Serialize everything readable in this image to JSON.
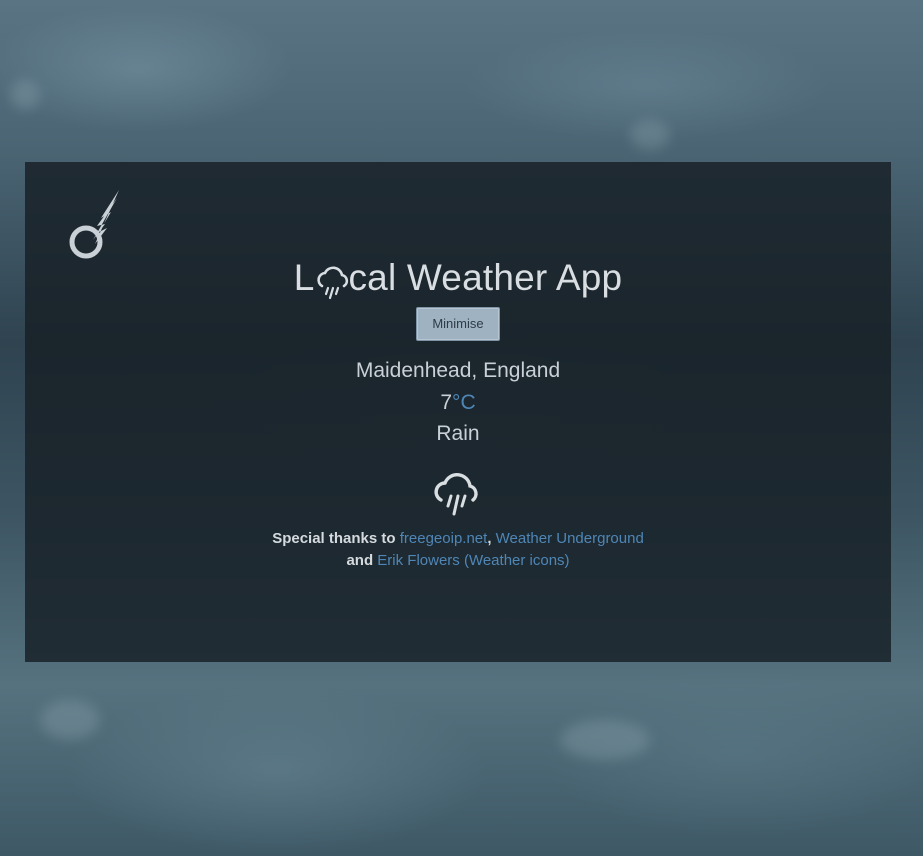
{
  "app": {
    "title_prefix": "L",
    "title_suffix": "cal Weather App",
    "title_icon": "rain-cloud-icon",
    "logo_icon": "comet-icon"
  },
  "controls": {
    "minimise_label": "Minimise"
  },
  "weather": {
    "location": "Maidenhead, England",
    "temperature": "7",
    "unit": "°C",
    "condition": "Rain",
    "icon": "rain-cloud-icon"
  },
  "credits": {
    "prefix": "Special thanks to",
    "link1": "freegeoip.net",
    "sep": ",",
    "link2": "Weather Underground",
    "and": "and",
    "link3": "Erik Flowers (Weather icons)"
  },
  "colors": {
    "accent": "#4f86b6",
    "card_bg": "#161e24",
    "text": "#c9d0d6"
  }
}
